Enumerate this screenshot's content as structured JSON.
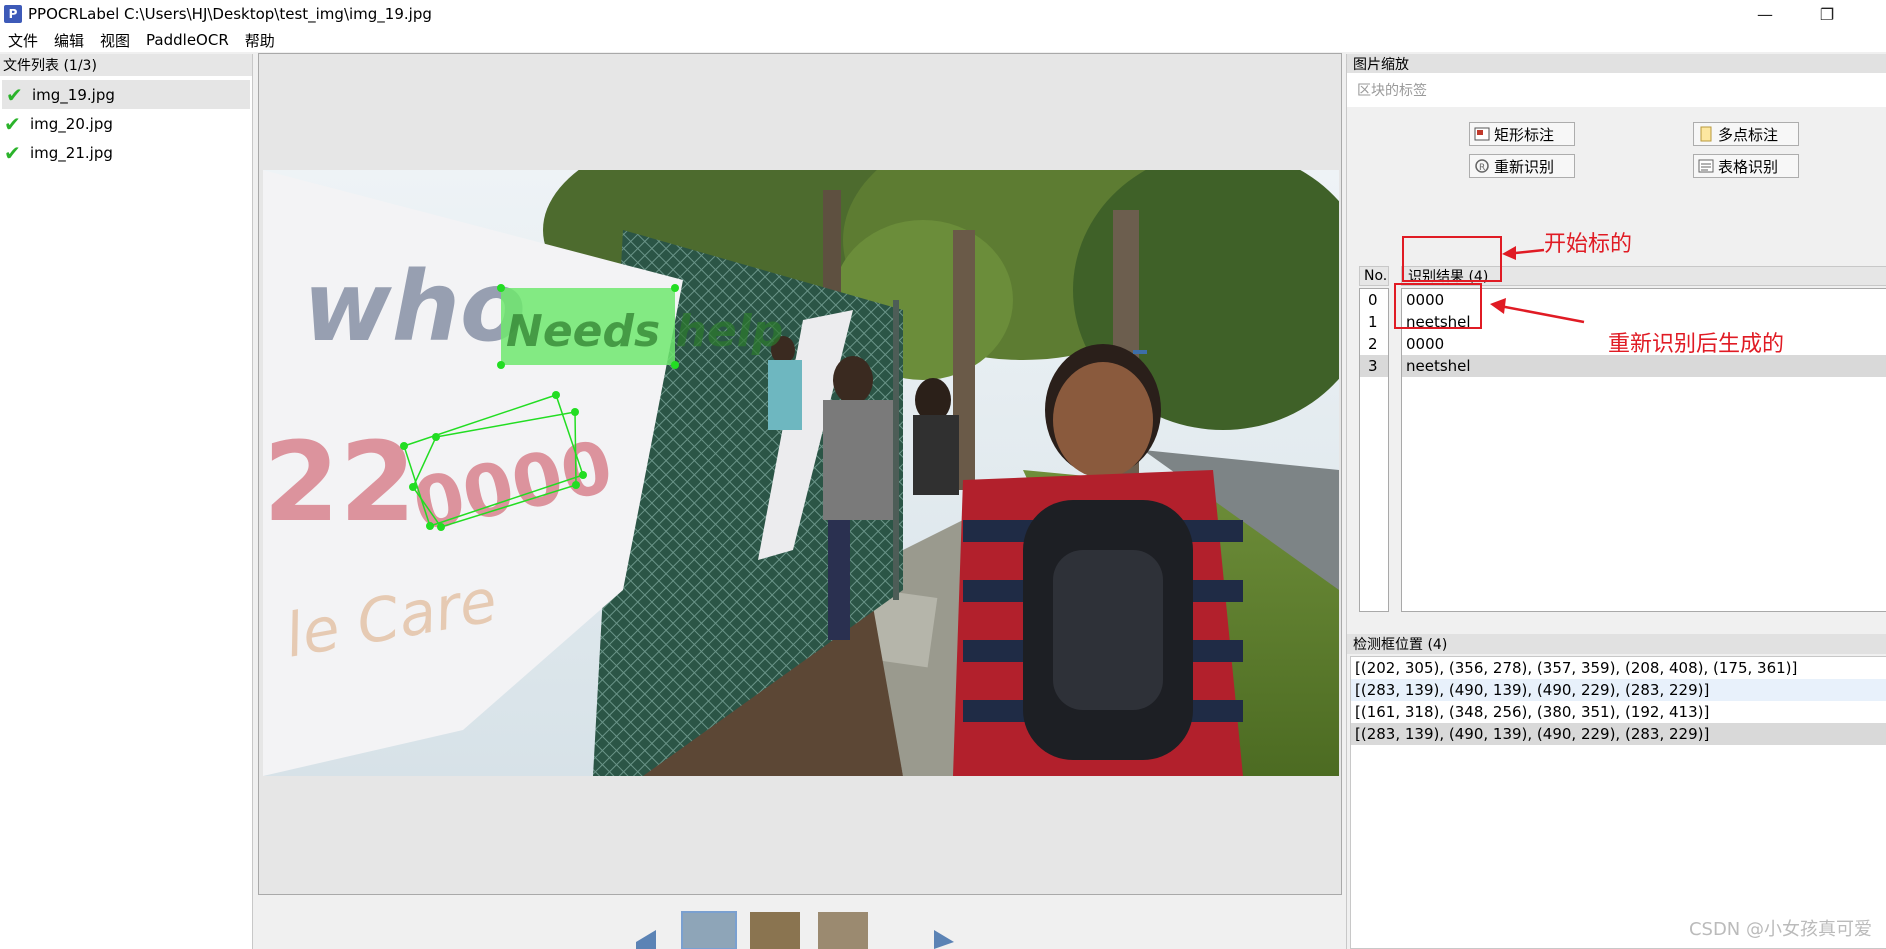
{
  "window": {
    "title": "PPOCRLabel C:\\Users\\HJ\\Desktop\\test_img\\img_19.jpg",
    "app_icon_letter": "P",
    "minimize_glyph": "—",
    "restore_glyph": "❐"
  },
  "menu": [
    "文件",
    "编辑",
    "视图",
    "PaddleOCR",
    "帮助"
  ],
  "file_list": {
    "title": "文件列表 (1/3)",
    "items": [
      "img_19.jpg",
      "img_20.jpg",
      "img_21.jpg"
    ],
    "selected_index": 0
  },
  "right_panel": {
    "zoom_title": "图片缩放",
    "label_hint": "区块的标签",
    "buttons": {
      "rect": "矩形标注",
      "poly": "多点标注",
      "rerecognize": "重新识别",
      "table": "表格识别"
    },
    "results": {
      "no_header": "No.",
      "header": "识别结果 (4)",
      "numbers": [
        "0",
        "1",
        "2",
        "3"
      ],
      "texts": [
        "0000",
        "neetshel",
        "0000",
        "neetshel"
      ],
      "selected_index": 3
    },
    "detection": {
      "title": "检测框位置 (4)",
      "rows": [
        "[(202, 305), (356, 278), (357, 359), (208, 408), (175, 361)]",
        "[(283, 139), (490, 139), (490, 229), (283, 229)]",
        "[(161, 318), (348, 256), (380, 351), (192, 413)]",
        "[(283, 139), (490, 139), (490, 229), (283, 229)]"
      ],
      "highlight_index": 1,
      "selected_index": 3
    }
  },
  "annotations": {
    "top": "开始标的",
    "bottom": "重新识别后生成的",
    "color": "#e01b24"
  },
  "watermark": "CSDN @小女孩真可爱",
  "colors": {
    "label_fill": "#6ee86e",
    "poly_stroke": "#22dd22",
    "check": "#2bb32b"
  }
}
